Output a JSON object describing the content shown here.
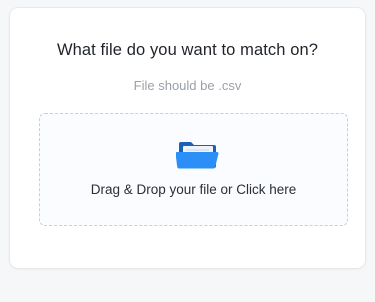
{
  "prompt": {
    "title": "What file do you want to match on?",
    "subtitle": "File should be .csv"
  },
  "dropzone": {
    "label": "Drag & Drop your file or Click here",
    "icon": "folder-icon"
  },
  "colors": {
    "folder_front": "#2b8ff7",
    "folder_back": "#1a5fb8",
    "paper": "#eef3fb",
    "dash_border": "#c9cfd8"
  }
}
